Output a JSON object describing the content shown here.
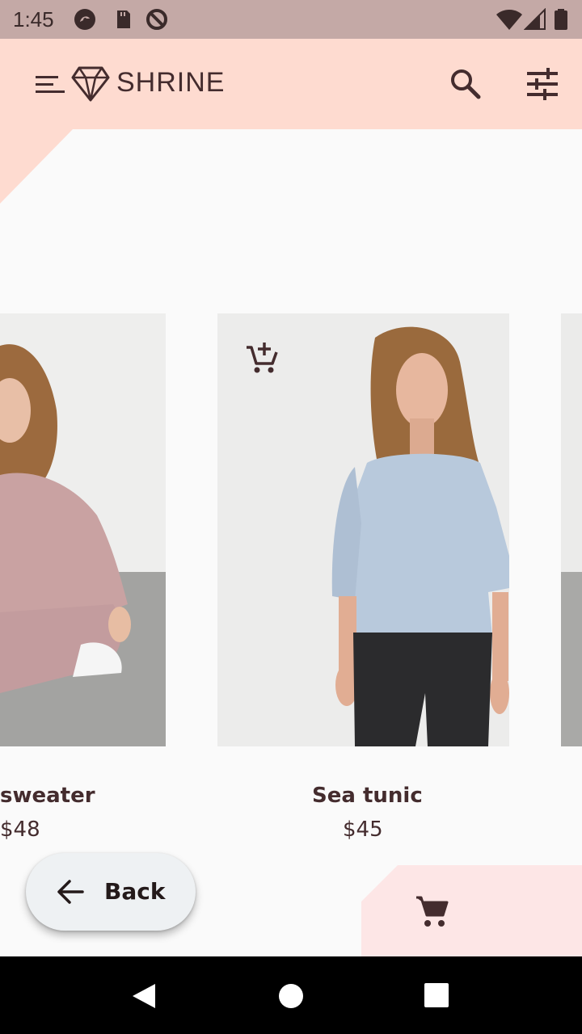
{
  "status_bar": {
    "time": "1:45",
    "icons": [
      "vpn-icon",
      "sd-card-icon",
      "data-saver-icon",
      "wifi-icon",
      "signal-icon",
      "battery-icon"
    ]
  },
  "top_bar": {
    "title": "SHRINE",
    "icons": [
      "menu-icon",
      "diamond-logo-icon",
      "search-icon",
      "filter-icon"
    ]
  },
  "products": [
    {
      "name": "sweater",
      "price": "$48",
      "image": "woman seated in mauve sweatsuit"
    },
    {
      "name": "Sea tunic",
      "price": "$45",
      "image": "man in light blue tunic and black trousers"
    },
    {
      "name": "",
      "price": "",
      "image": "partially visible product"
    }
  ],
  "back_button": {
    "label": "Back",
    "icon": "arrow-back-icon"
  },
  "cart": {
    "icon": "shopping-cart-icon"
  },
  "colors": {
    "primary": "#fedbd0",
    "status_bar": "#c4a9a6",
    "text": "#442c2e",
    "cart_panel": "#fde6e6",
    "background": "#fafafa"
  }
}
